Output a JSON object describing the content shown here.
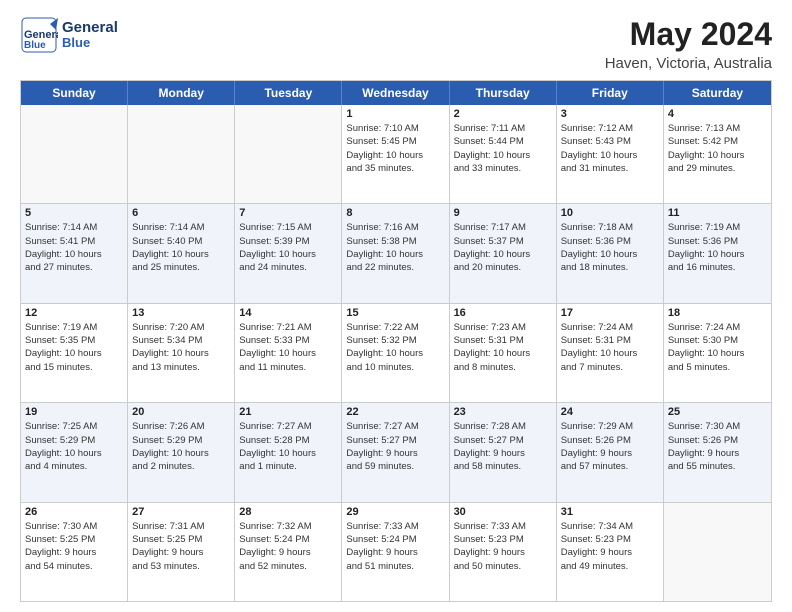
{
  "header": {
    "logo_line1": "General",
    "logo_line2": "Blue",
    "title": "May 2024",
    "subtitle": "Haven, Victoria, Australia"
  },
  "weekdays": [
    "Sunday",
    "Monday",
    "Tuesday",
    "Wednesday",
    "Thursday",
    "Friday",
    "Saturday"
  ],
  "rows": [
    {
      "alt": false,
      "cells": [
        {
          "day": "",
          "info": ""
        },
        {
          "day": "",
          "info": ""
        },
        {
          "day": "",
          "info": ""
        },
        {
          "day": "1",
          "info": "Sunrise: 7:10 AM\nSunset: 5:45 PM\nDaylight: 10 hours\nand 35 minutes."
        },
        {
          "day": "2",
          "info": "Sunrise: 7:11 AM\nSunset: 5:44 PM\nDaylight: 10 hours\nand 33 minutes."
        },
        {
          "day": "3",
          "info": "Sunrise: 7:12 AM\nSunset: 5:43 PM\nDaylight: 10 hours\nand 31 minutes."
        },
        {
          "day": "4",
          "info": "Sunrise: 7:13 AM\nSunset: 5:42 PM\nDaylight: 10 hours\nand 29 minutes."
        }
      ]
    },
    {
      "alt": true,
      "cells": [
        {
          "day": "5",
          "info": "Sunrise: 7:14 AM\nSunset: 5:41 PM\nDaylight: 10 hours\nand 27 minutes."
        },
        {
          "day": "6",
          "info": "Sunrise: 7:14 AM\nSunset: 5:40 PM\nDaylight: 10 hours\nand 25 minutes."
        },
        {
          "day": "7",
          "info": "Sunrise: 7:15 AM\nSunset: 5:39 PM\nDaylight: 10 hours\nand 24 minutes."
        },
        {
          "day": "8",
          "info": "Sunrise: 7:16 AM\nSunset: 5:38 PM\nDaylight: 10 hours\nand 22 minutes."
        },
        {
          "day": "9",
          "info": "Sunrise: 7:17 AM\nSunset: 5:37 PM\nDaylight: 10 hours\nand 20 minutes."
        },
        {
          "day": "10",
          "info": "Sunrise: 7:18 AM\nSunset: 5:36 PM\nDaylight: 10 hours\nand 18 minutes."
        },
        {
          "day": "11",
          "info": "Sunrise: 7:19 AM\nSunset: 5:36 PM\nDaylight: 10 hours\nand 16 minutes."
        }
      ]
    },
    {
      "alt": false,
      "cells": [
        {
          "day": "12",
          "info": "Sunrise: 7:19 AM\nSunset: 5:35 PM\nDaylight: 10 hours\nand 15 minutes."
        },
        {
          "day": "13",
          "info": "Sunrise: 7:20 AM\nSunset: 5:34 PM\nDaylight: 10 hours\nand 13 minutes."
        },
        {
          "day": "14",
          "info": "Sunrise: 7:21 AM\nSunset: 5:33 PM\nDaylight: 10 hours\nand 11 minutes."
        },
        {
          "day": "15",
          "info": "Sunrise: 7:22 AM\nSunset: 5:32 PM\nDaylight: 10 hours\nand 10 minutes."
        },
        {
          "day": "16",
          "info": "Sunrise: 7:23 AM\nSunset: 5:31 PM\nDaylight: 10 hours\nand 8 minutes."
        },
        {
          "day": "17",
          "info": "Sunrise: 7:24 AM\nSunset: 5:31 PM\nDaylight: 10 hours\nand 7 minutes."
        },
        {
          "day": "18",
          "info": "Sunrise: 7:24 AM\nSunset: 5:30 PM\nDaylight: 10 hours\nand 5 minutes."
        }
      ]
    },
    {
      "alt": true,
      "cells": [
        {
          "day": "19",
          "info": "Sunrise: 7:25 AM\nSunset: 5:29 PM\nDaylight: 10 hours\nand 4 minutes."
        },
        {
          "day": "20",
          "info": "Sunrise: 7:26 AM\nSunset: 5:29 PM\nDaylight: 10 hours\nand 2 minutes."
        },
        {
          "day": "21",
          "info": "Sunrise: 7:27 AM\nSunset: 5:28 PM\nDaylight: 10 hours\nand 1 minute."
        },
        {
          "day": "22",
          "info": "Sunrise: 7:27 AM\nSunset: 5:27 PM\nDaylight: 9 hours\nand 59 minutes."
        },
        {
          "day": "23",
          "info": "Sunrise: 7:28 AM\nSunset: 5:27 PM\nDaylight: 9 hours\nand 58 minutes."
        },
        {
          "day": "24",
          "info": "Sunrise: 7:29 AM\nSunset: 5:26 PM\nDaylight: 9 hours\nand 57 minutes."
        },
        {
          "day": "25",
          "info": "Sunrise: 7:30 AM\nSunset: 5:26 PM\nDaylight: 9 hours\nand 55 minutes."
        }
      ]
    },
    {
      "alt": false,
      "cells": [
        {
          "day": "26",
          "info": "Sunrise: 7:30 AM\nSunset: 5:25 PM\nDaylight: 9 hours\nand 54 minutes."
        },
        {
          "day": "27",
          "info": "Sunrise: 7:31 AM\nSunset: 5:25 PM\nDaylight: 9 hours\nand 53 minutes."
        },
        {
          "day": "28",
          "info": "Sunrise: 7:32 AM\nSunset: 5:24 PM\nDaylight: 9 hours\nand 52 minutes."
        },
        {
          "day": "29",
          "info": "Sunrise: 7:33 AM\nSunset: 5:24 PM\nDaylight: 9 hours\nand 51 minutes."
        },
        {
          "day": "30",
          "info": "Sunrise: 7:33 AM\nSunset: 5:23 PM\nDaylight: 9 hours\nand 50 minutes."
        },
        {
          "day": "31",
          "info": "Sunrise: 7:34 AM\nSunset: 5:23 PM\nDaylight: 9 hours\nand 49 minutes."
        },
        {
          "day": "",
          "info": ""
        }
      ]
    }
  ]
}
